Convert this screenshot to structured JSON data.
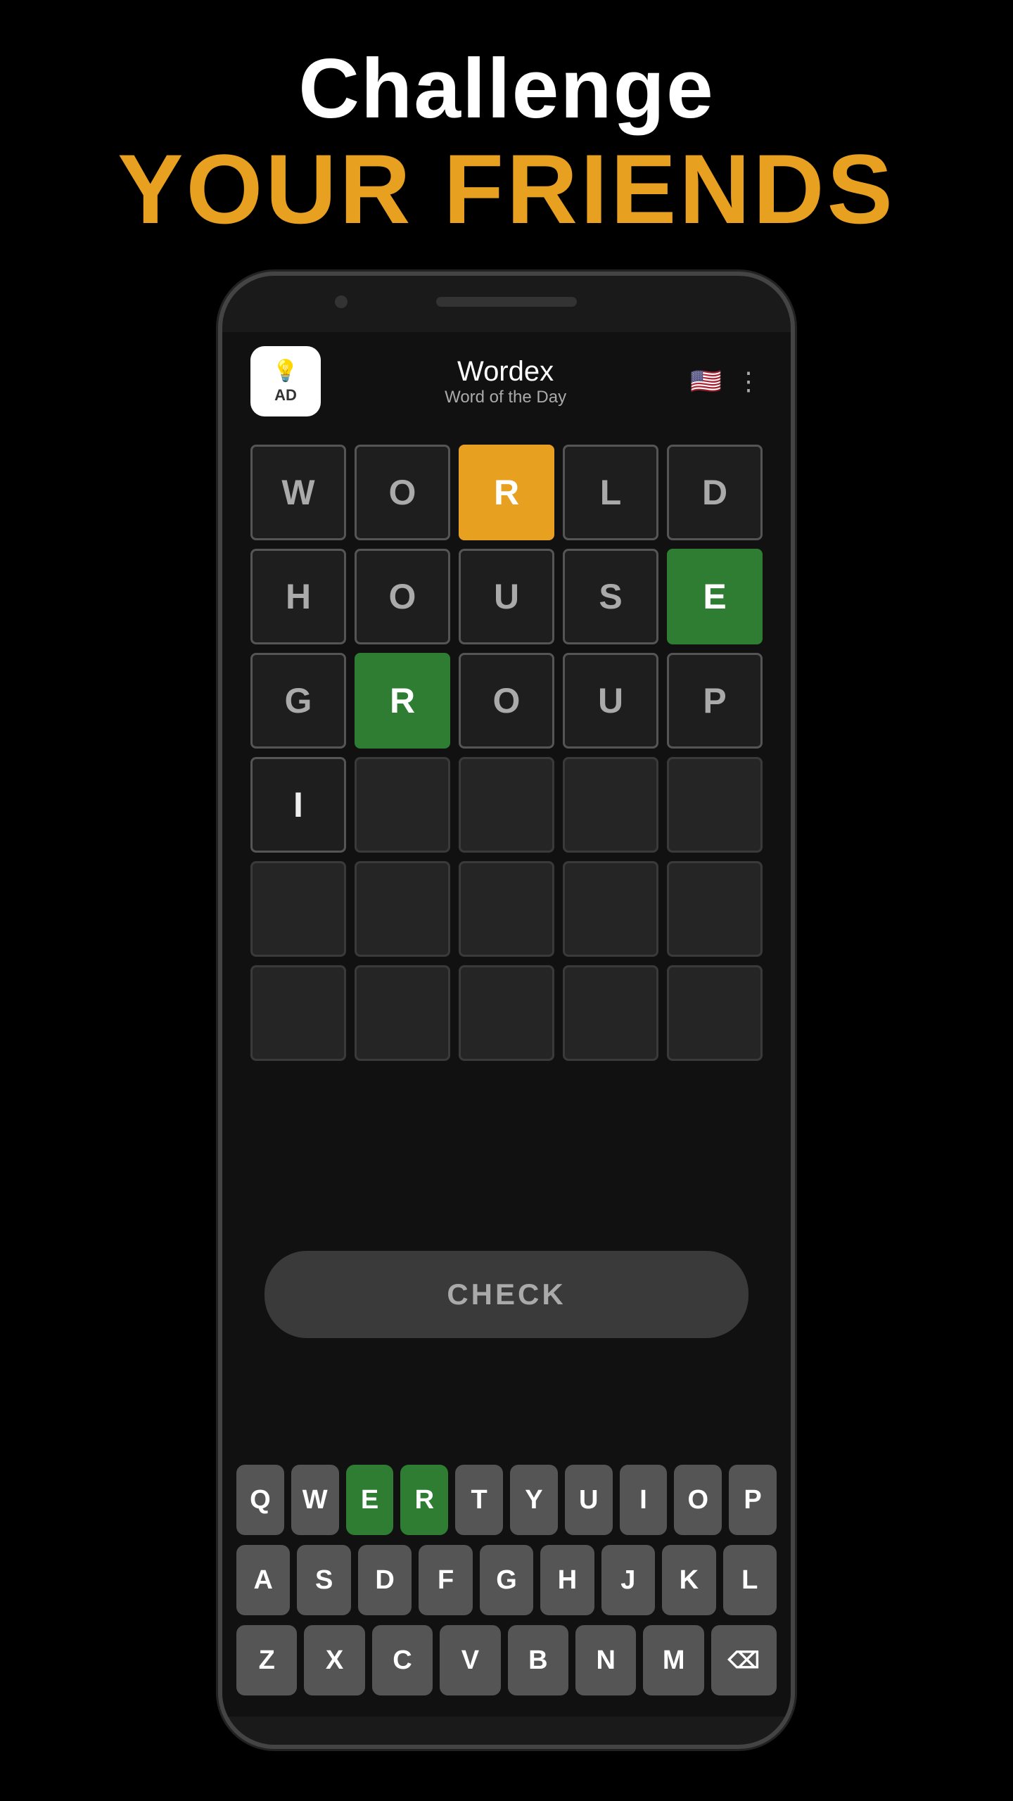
{
  "header": {
    "challenge_label": "Challenge",
    "friends_label": "YOUR FRIENDS"
  },
  "app": {
    "ad_label": "AD",
    "bulb_icon": "💡",
    "title": "Wordex",
    "subtitle": "Word of the Day",
    "flag_icon": "🇺🇸",
    "menu_icon": "⋮"
  },
  "grid": {
    "rows": [
      [
        {
          "letter": "W",
          "state": "normal"
        },
        {
          "letter": "O",
          "state": "normal"
        },
        {
          "letter": "R",
          "state": "orange"
        },
        {
          "letter": "L",
          "state": "normal"
        },
        {
          "letter": "D",
          "state": "normal"
        }
      ],
      [
        {
          "letter": "H",
          "state": "normal"
        },
        {
          "letter": "O",
          "state": "normal"
        },
        {
          "letter": "U",
          "state": "normal"
        },
        {
          "letter": "S",
          "state": "normal"
        },
        {
          "letter": "E",
          "state": "green"
        }
      ],
      [
        {
          "letter": "G",
          "state": "normal"
        },
        {
          "letter": "R",
          "state": "green"
        },
        {
          "letter": "O",
          "state": "normal"
        },
        {
          "letter": "U",
          "state": "normal"
        },
        {
          "letter": "P",
          "state": "normal"
        }
      ],
      [
        {
          "letter": "I",
          "state": "white-letter"
        },
        {
          "letter": "",
          "state": "empty"
        },
        {
          "letter": "",
          "state": "empty"
        },
        {
          "letter": "",
          "state": "empty"
        },
        {
          "letter": "",
          "state": "empty"
        }
      ],
      [
        {
          "letter": "",
          "state": "empty"
        },
        {
          "letter": "",
          "state": "empty"
        },
        {
          "letter": "",
          "state": "empty"
        },
        {
          "letter": "",
          "state": "empty"
        },
        {
          "letter": "",
          "state": "empty"
        }
      ],
      [
        {
          "letter": "",
          "state": "empty"
        },
        {
          "letter": "",
          "state": "empty"
        },
        {
          "letter": "",
          "state": "empty"
        },
        {
          "letter": "",
          "state": "empty"
        },
        {
          "letter": "",
          "state": "empty"
        }
      ]
    ]
  },
  "check_button": {
    "label": "CHECK"
  },
  "keyboard": {
    "rows": [
      [
        {
          "key": "Q",
          "state": "normal"
        },
        {
          "key": "W",
          "state": "normal"
        },
        {
          "key": "E",
          "state": "green"
        },
        {
          "key": "R",
          "state": "green"
        },
        {
          "key": "T",
          "state": "normal"
        },
        {
          "key": "Y",
          "state": "normal"
        },
        {
          "key": "U",
          "state": "normal"
        },
        {
          "key": "I",
          "state": "normal"
        },
        {
          "key": "O",
          "state": "normal"
        },
        {
          "key": "P",
          "state": "normal"
        }
      ],
      [
        {
          "key": "A",
          "state": "normal"
        },
        {
          "key": "S",
          "state": "normal"
        },
        {
          "key": "D",
          "state": "normal"
        },
        {
          "key": "F",
          "state": "normal"
        },
        {
          "key": "G",
          "state": "normal"
        },
        {
          "key": "H",
          "state": "normal"
        },
        {
          "key": "J",
          "state": "normal"
        },
        {
          "key": "K",
          "state": "normal"
        },
        {
          "key": "L",
          "state": "normal"
        }
      ],
      [
        {
          "key": "Z",
          "state": "normal"
        },
        {
          "key": "X",
          "state": "normal"
        },
        {
          "key": "C",
          "state": "normal"
        },
        {
          "key": "V",
          "state": "normal"
        },
        {
          "key": "B",
          "state": "normal"
        },
        {
          "key": "N",
          "state": "normal"
        },
        {
          "key": "M",
          "state": "normal"
        },
        {
          "key": "⌫",
          "state": "backspace"
        }
      ]
    ]
  }
}
